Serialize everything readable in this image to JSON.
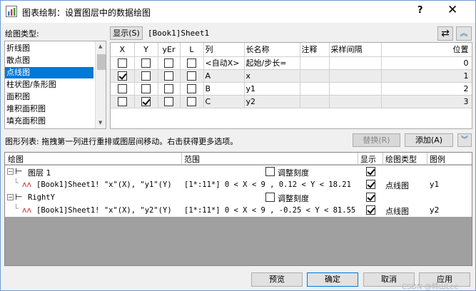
{
  "window": {
    "title": "图表绘制：设置图层中的数据绘图",
    "help": "?",
    "close": "✕"
  },
  "plot_type": {
    "label": "绘图类型:",
    "items": [
      "折线图",
      "散点图",
      "点线图",
      "柱状图/条形图",
      "面积图",
      "堆积面积图",
      "填充面积图"
    ],
    "selected": "点线图"
  },
  "columns_panel": {
    "show_button": "显示(S)",
    "sheet": "[Book1]Sheet1",
    "headers": [
      "X",
      "Y",
      "yEr",
      "L",
      "列",
      "长名称",
      "注释",
      "采样间隔",
      "位置"
    ],
    "rows": [
      {
        "x": false,
        "y": false,
        "yer": false,
        "l": false,
        "col": "<自动X>",
        "longname": "起始/步长=",
        "comment": "",
        "sampling": "",
        "pos": "0"
      },
      {
        "x": true,
        "y": false,
        "yer": false,
        "l": false,
        "col": "A",
        "longname": "x",
        "comment": "",
        "sampling": "",
        "pos": "1"
      },
      {
        "x": false,
        "y": false,
        "yer": false,
        "l": false,
        "col": "B",
        "longname": "y1",
        "comment": "",
        "sampling": "",
        "pos": "2"
      },
      {
        "x": false,
        "y": true,
        "yer": false,
        "l": false,
        "col": "C",
        "longname": "y2",
        "comment": "",
        "sampling": "",
        "pos": "3"
      }
    ]
  },
  "plot_list": {
    "label": "图形列表: 拖拽第一列进行重排或图层间移动。右击获得更多选项。",
    "replace_button": "替换(R)",
    "add_button": "添加(A)",
    "headers": [
      "绘图",
      "范围",
      "显示",
      "绘图类型",
      "图例"
    ],
    "layers": [
      {
        "name": "图层 1",
        "rescale_label": "调整刻度",
        "rescale": false,
        "show": true,
        "plot": {
          "data": "[Book1]Sheet1! \"x\"(X), \"y1\"(Y)",
          "range": "[1*:11*]  0 < X < 9 , 0.12 < Y < 18.21",
          "show": true,
          "type": "点线图",
          "legend": "y1"
        }
      },
      {
        "name": "RightY",
        "rescale_label": "调整刻度",
        "rescale": false,
        "show": true,
        "plot": {
          "data": "[Book1]Sheet1! \"x\"(X), \"y2\"(Y)",
          "range": "[1*:11*]  0 < X < 9 , -0.25 < Y < 81.55",
          "show": true,
          "type": "点线图",
          "legend": "y2"
        }
      }
    ]
  },
  "footer": {
    "preview": "预览",
    "ok": "确定",
    "cancel": "取消",
    "apply": "应用"
  },
  "watermark": "CSDN @韩山Lee",
  "colors": {
    "selection": "#0078d7",
    "border": "#6d9bd1",
    "wave": "#d03030"
  }
}
